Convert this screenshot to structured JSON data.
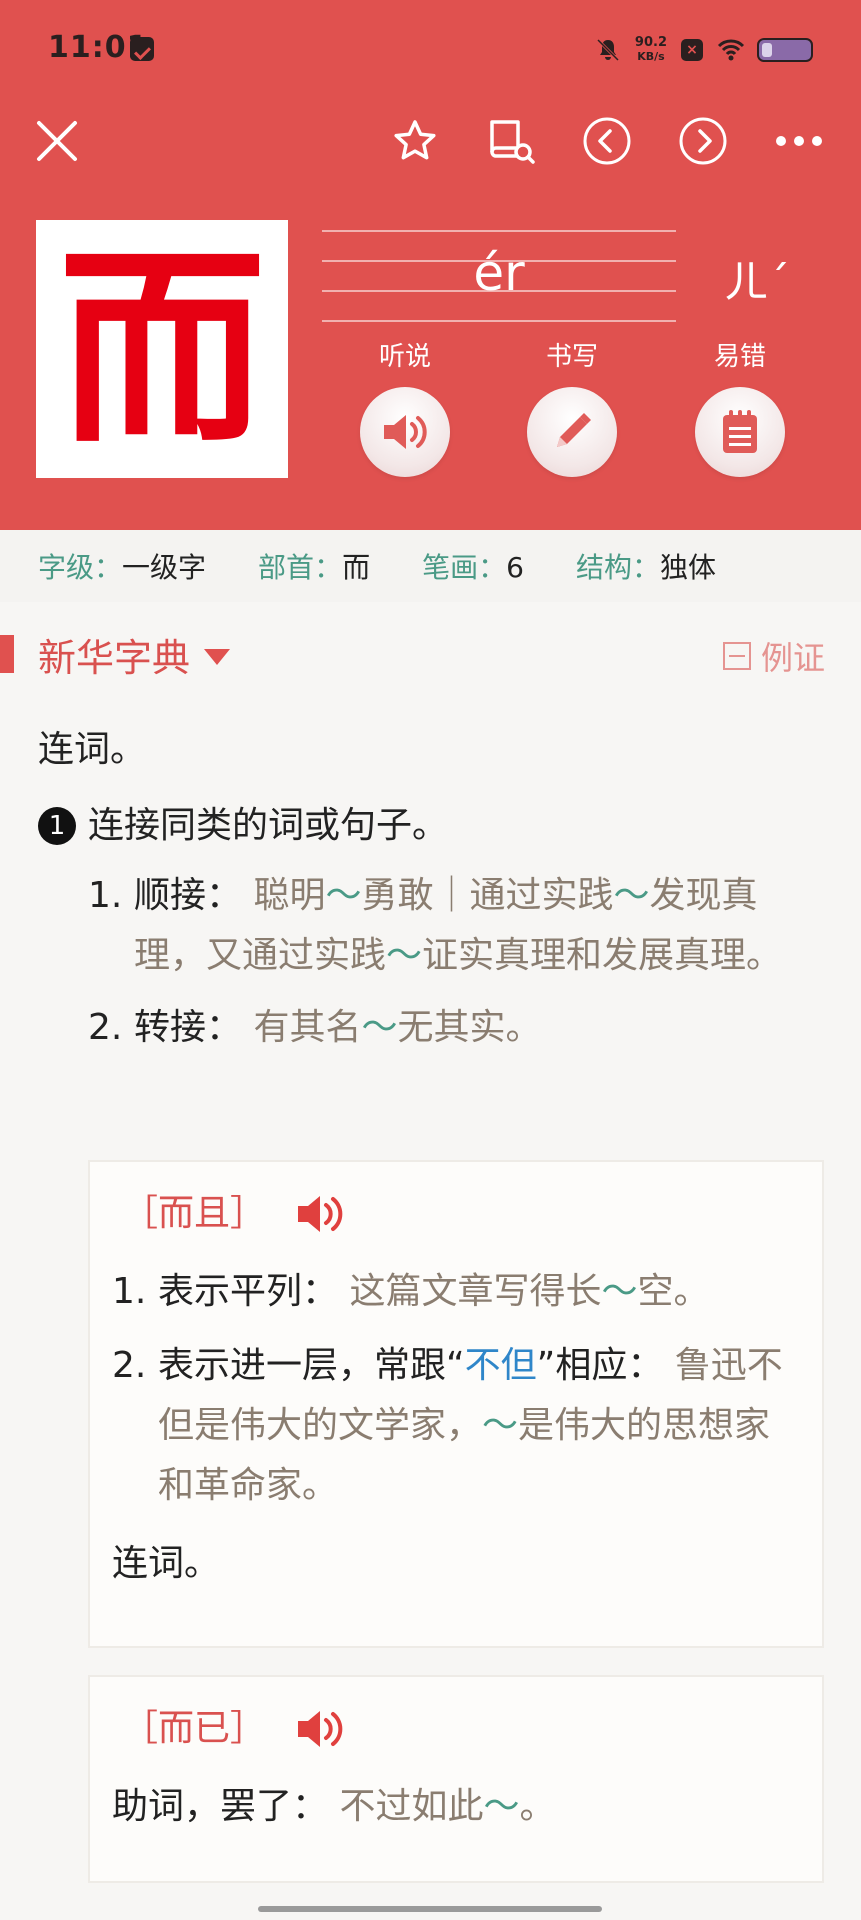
{
  "status": {
    "time": "11:01",
    "net_speed": "90.2",
    "net_unit": "KB/s",
    "x_badge": "×"
  },
  "entry": {
    "character": "而",
    "pinyin": "ér",
    "zhuyin": "ㄦˊ"
  },
  "actions": [
    {
      "label": "听说",
      "icon": "speaker-icon"
    },
    {
      "label": "书写",
      "icon": "pencil-icon"
    },
    {
      "label": "易错",
      "icon": "notepad-icon"
    }
  ],
  "info": [
    {
      "key": "字级",
      "sep": "：",
      "value": "一级字"
    },
    {
      "key": "部首",
      "sep": "：",
      "value": "而"
    },
    {
      "key": "笔画",
      "sep": "：",
      "value": "6"
    },
    {
      "key": "结构",
      "sep": "：",
      "value": "独体"
    }
  ],
  "dictionary": {
    "title": "新华字典",
    "example_toggle": "例证",
    "part_of_speech": "连词。",
    "sense_number": "1",
    "sense_text": "连接同类的词或句子。",
    "subsenses": [
      {
        "num": "1.",
        "label": "顺接：",
        "ex_parts": [
          "聪明",
          "～",
          "勇敢｜通过实践",
          "～",
          "发现真理，又通过实践",
          "～",
          "证实真理和发展真理。"
        ]
      },
      {
        "num": "2.",
        "label": "转接：",
        "ex_parts": [
          "有其名",
          "～",
          "无其实。"
        ]
      }
    ]
  },
  "words": [
    {
      "title": "［而且］",
      "items": [
        {
          "num": "1.",
          "label": "表示平列：",
          "ex_a": "这篇文章写得长",
          "tilde": "～",
          "ex_b": "空。"
        },
        {
          "num": "2.",
          "label_a": "表示进一层，常跟“",
          "link": "不但",
          "label_b": "”相应：",
          "ex_a": "鲁迅不但是伟大的文学家，",
          "tilde": "～",
          "ex_b": "是伟大的思想家和革命家。"
        }
      ],
      "pos": "连词。"
    },
    {
      "title": "［而已］",
      "label": "助词，罢了：",
      "ex_a": "不过如此",
      "tilde": "～",
      "ex_b": "。"
    }
  ]
}
